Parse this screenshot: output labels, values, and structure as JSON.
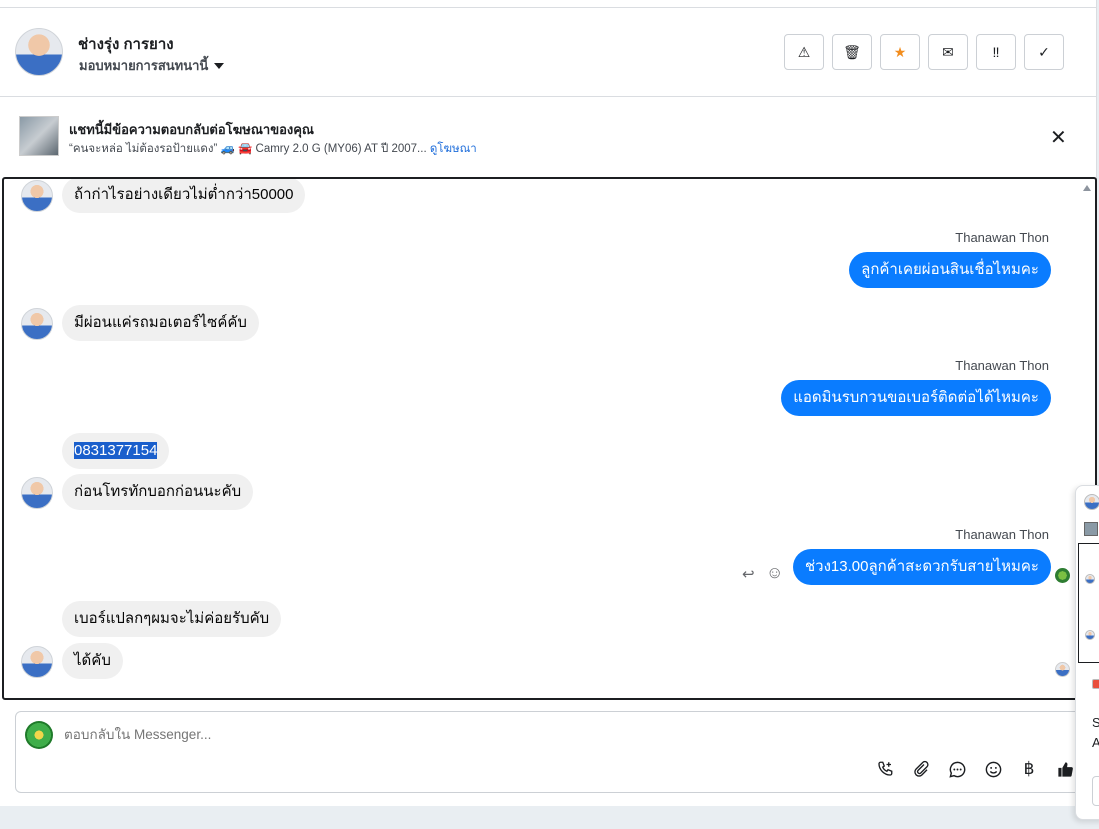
{
  "header": {
    "contact_name": "ช่างรุ่ง การยาง",
    "assign_label": "มอบหมายการสนทนานี้",
    "actions": [
      {
        "name": "report-spam-button",
        "icon": "warning-icon",
        "glyph": "⚠"
      },
      {
        "name": "delete-button",
        "icon": "trash-icon",
        "glyph": "🗑"
      },
      {
        "name": "star-button",
        "icon": "star-icon",
        "glyph": "★"
      },
      {
        "name": "mark-unread-button",
        "icon": "envelope-icon",
        "glyph": "✉"
      },
      {
        "name": "follow-up-button",
        "icon": "double-exclamation-icon",
        "glyph": "‼"
      },
      {
        "name": "mark-done-button",
        "icon": "check-icon",
        "glyph": "✓"
      }
    ]
  },
  "ad_banner": {
    "title": "แชทนี้มีข้อความตอบกลับต่อโฆษณาของคุณ",
    "subtitle": "“คนจะหล่อ ไม่ต้องรอป้ายแดง” 🚙 🚘 Camry 2.0 G (MY06) AT ปี 2007...",
    "link_label": "ดูโฆษณา",
    "close_glyph": "✕"
  },
  "messages": {
    "m1": "ถ้าก่าไรอย่างเดียวไม่ต่ำกว่า50000",
    "s1": "Thanawan Thon",
    "m2": "ลูกค้าเคยผ่อนสินเชื่อไหมคะ",
    "m3": "มีผ่อนแค่รถมอเตอร์ไซค์คับ",
    "s2": "Thanawan Thon",
    "m4": "แอดมินรบกวนขอเบอร์ติดต่อได้ไหมคะ",
    "m5": "0831377154",
    "m6": "ก่อนโทรทักบอกก่อนนะคับ",
    "s3": "Thanawan Thon",
    "m7": "ช่วง13.00ลูกค้าสะดวกรับสายไหมคะ",
    "m8": "เบอร์แปลกๆผมจะไม่ค่อยรับคับ",
    "m9": "ได้คับ"
  },
  "composer": {
    "placeholder": "ตอบกลับใน Messenger...",
    "tools": [
      {
        "name": "call-icon",
        "glyph": "📞"
      },
      {
        "name": "attach-icon",
        "glyph": "📎"
      },
      {
        "name": "saved-reply-icon",
        "glyph": "💬"
      },
      {
        "name": "emoji-icon",
        "glyph": "☺"
      },
      {
        "name": "baht-icon",
        "glyph": "฿"
      },
      {
        "name": "like-icon",
        "glyph": "👍"
      }
    ]
  },
  "side_widget": {
    "text1": "S",
    "text2": "A"
  }
}
